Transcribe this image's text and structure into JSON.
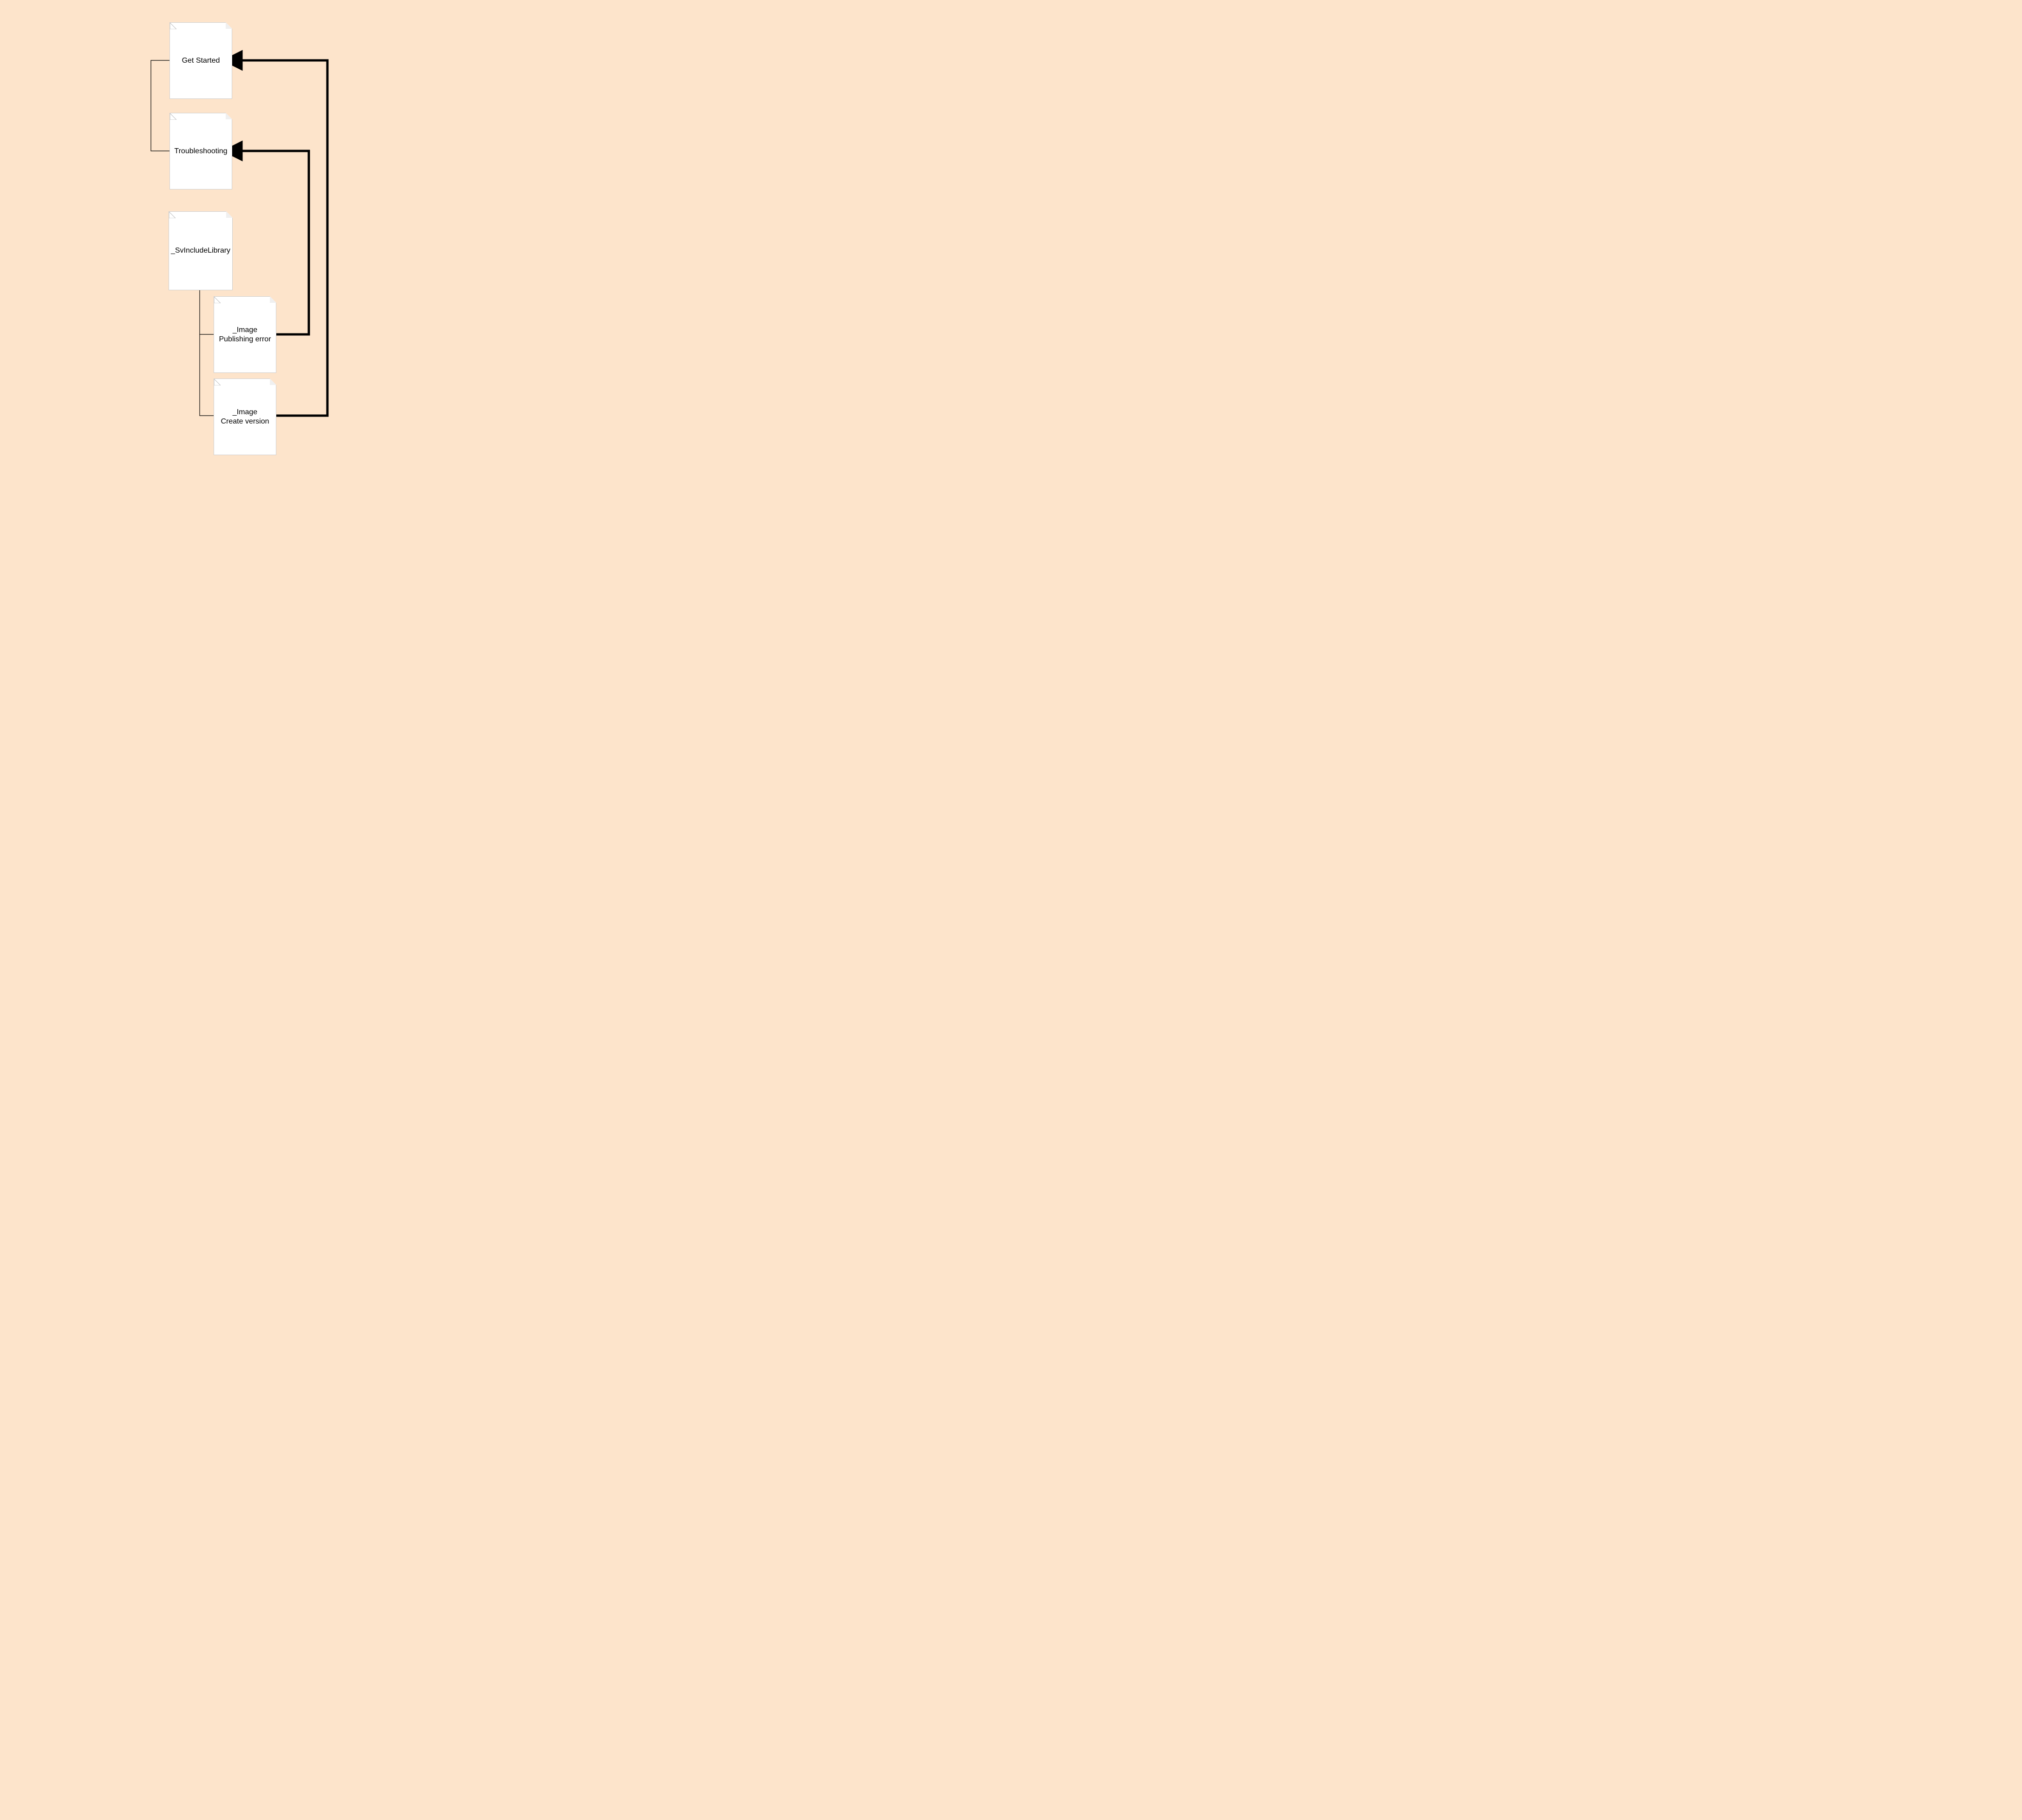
{
  "nodes": {
    "get_started": {
      "label": "Get Started"
    },
    "troubleshooting": {
      "label": "Troubleshooting"
    },
    "sv_include_library": {
      "label": "_SvIncludeLibrary"
    },
    "image_publishing_error": {
      "label": "_Image\nPublishing error"
    },
    "image_create_version": {
      "label": "_Image\nCreate version"
    }
  }
}
